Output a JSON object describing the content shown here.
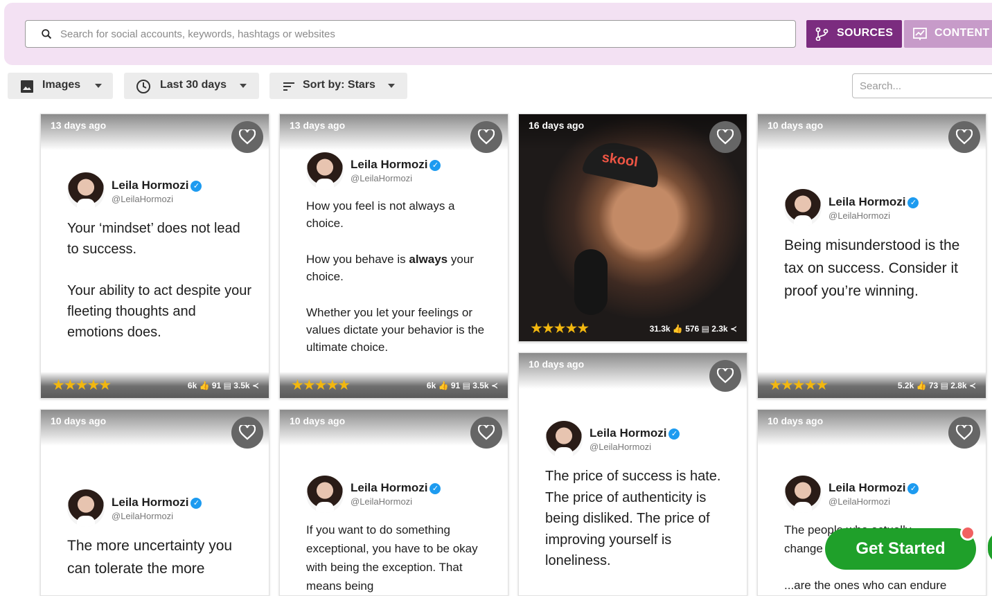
{
  "search": {
    "placeholder": "Search for social accounts, keywords, hashtags or websites"
  },
  "header_buttons": {
    "sources": "SOURCES",
    "content": "CONTENT"
  },
  "filters": {
    "type": "Images",
    "range": "Last 30 days",
    "sort": "Sort by: Stars"
  },
  "side_search": {
    "placeholder": "Search..."
  },
  "colors": {
    "primary": "#7b2c7f",
    "accent_light": "#c79bc9",
    "topbar": "#f3e1f3",
    "cta": "#1fa02a",
    "stars": "#f2b70f"
  },
  "cards": [
    {
      "age": "13 days ago",
      "name": "Leila Hormozi",
      "handle": "@LeilaHormozi",
      "p1": "Your ‘mindset’ does not lead to success.",
      "p2": "Your ability to act despite your fleeting thoughts and emotions does.",
      "stars": "★★★★★",
      "likes": "6k",
      "comments": "91",
      "shares": "3.5k"
    },
    {
      "age": "13 days ago",
      "name": "Leila Hormozi",
      "handle": "@LeilaHormozi",
      "p1": "How you feel is not always a choice.",
      "p2a": "How you behave is ",
      "p2b": "always",
      "p2c": " your choice.",
      "p3": "Whether you let your feelings or values dictate your behavior is the ultimate choice.",
      "stars": "★★★★★",
      "likes": "6k",
      "comments": "91",
      "shares": "3.5k"
    },
    {
      "age": "16 days ago",
      "cap_text": "skool",
      "stars": "★★★★★",
      "likes": "31.3k",
      "comments": "576",
      "shares": "2.3k"
    },
    {
      "age": "10 days ago",
      "name": "Leila Hormozi",
      "handle": "@LeilaHormozi",
      "p1": "Being misunderstood is the tax on success. Consider it proof you’re winning.",
      "stars": "★★★★★",
      "likes": "5.2k",
      "comments": "73",
      "shares": "2.8k"
    },
    {
      "age": "10 days ago",
      "name": "Leila Hormozi",
      "handle": "@LeilaHormozi",
      "p1": "The more uncertainty you can tolerate the more"
    },
    {
      "age": "10 days ago",
      "name": "Leila Hormozi",
      "handle": "@LeilaHormozi",
      "p1": "If you want to do something exceptional, you have to be okay with being the exception. That means being"
    },
    {
      "age": "10 days ago",
      "name": "Leila Hormozi",
      "handle": "@LeilaHormozi",
      "p1": "The price of success is hate. The price of authenticity is being disliked. The price of improving yourself is loneliness."
    },
    {
      "age": "10 days ago",
      "name": "Leila Hormozi",
      "handle": "@LeilaHormozi",
      "p1": "The people who actually change",
      "p2": "...are the ones who can endure"
    }
  ],
  "cta": {
    "label": "Get Started"
  }
}
